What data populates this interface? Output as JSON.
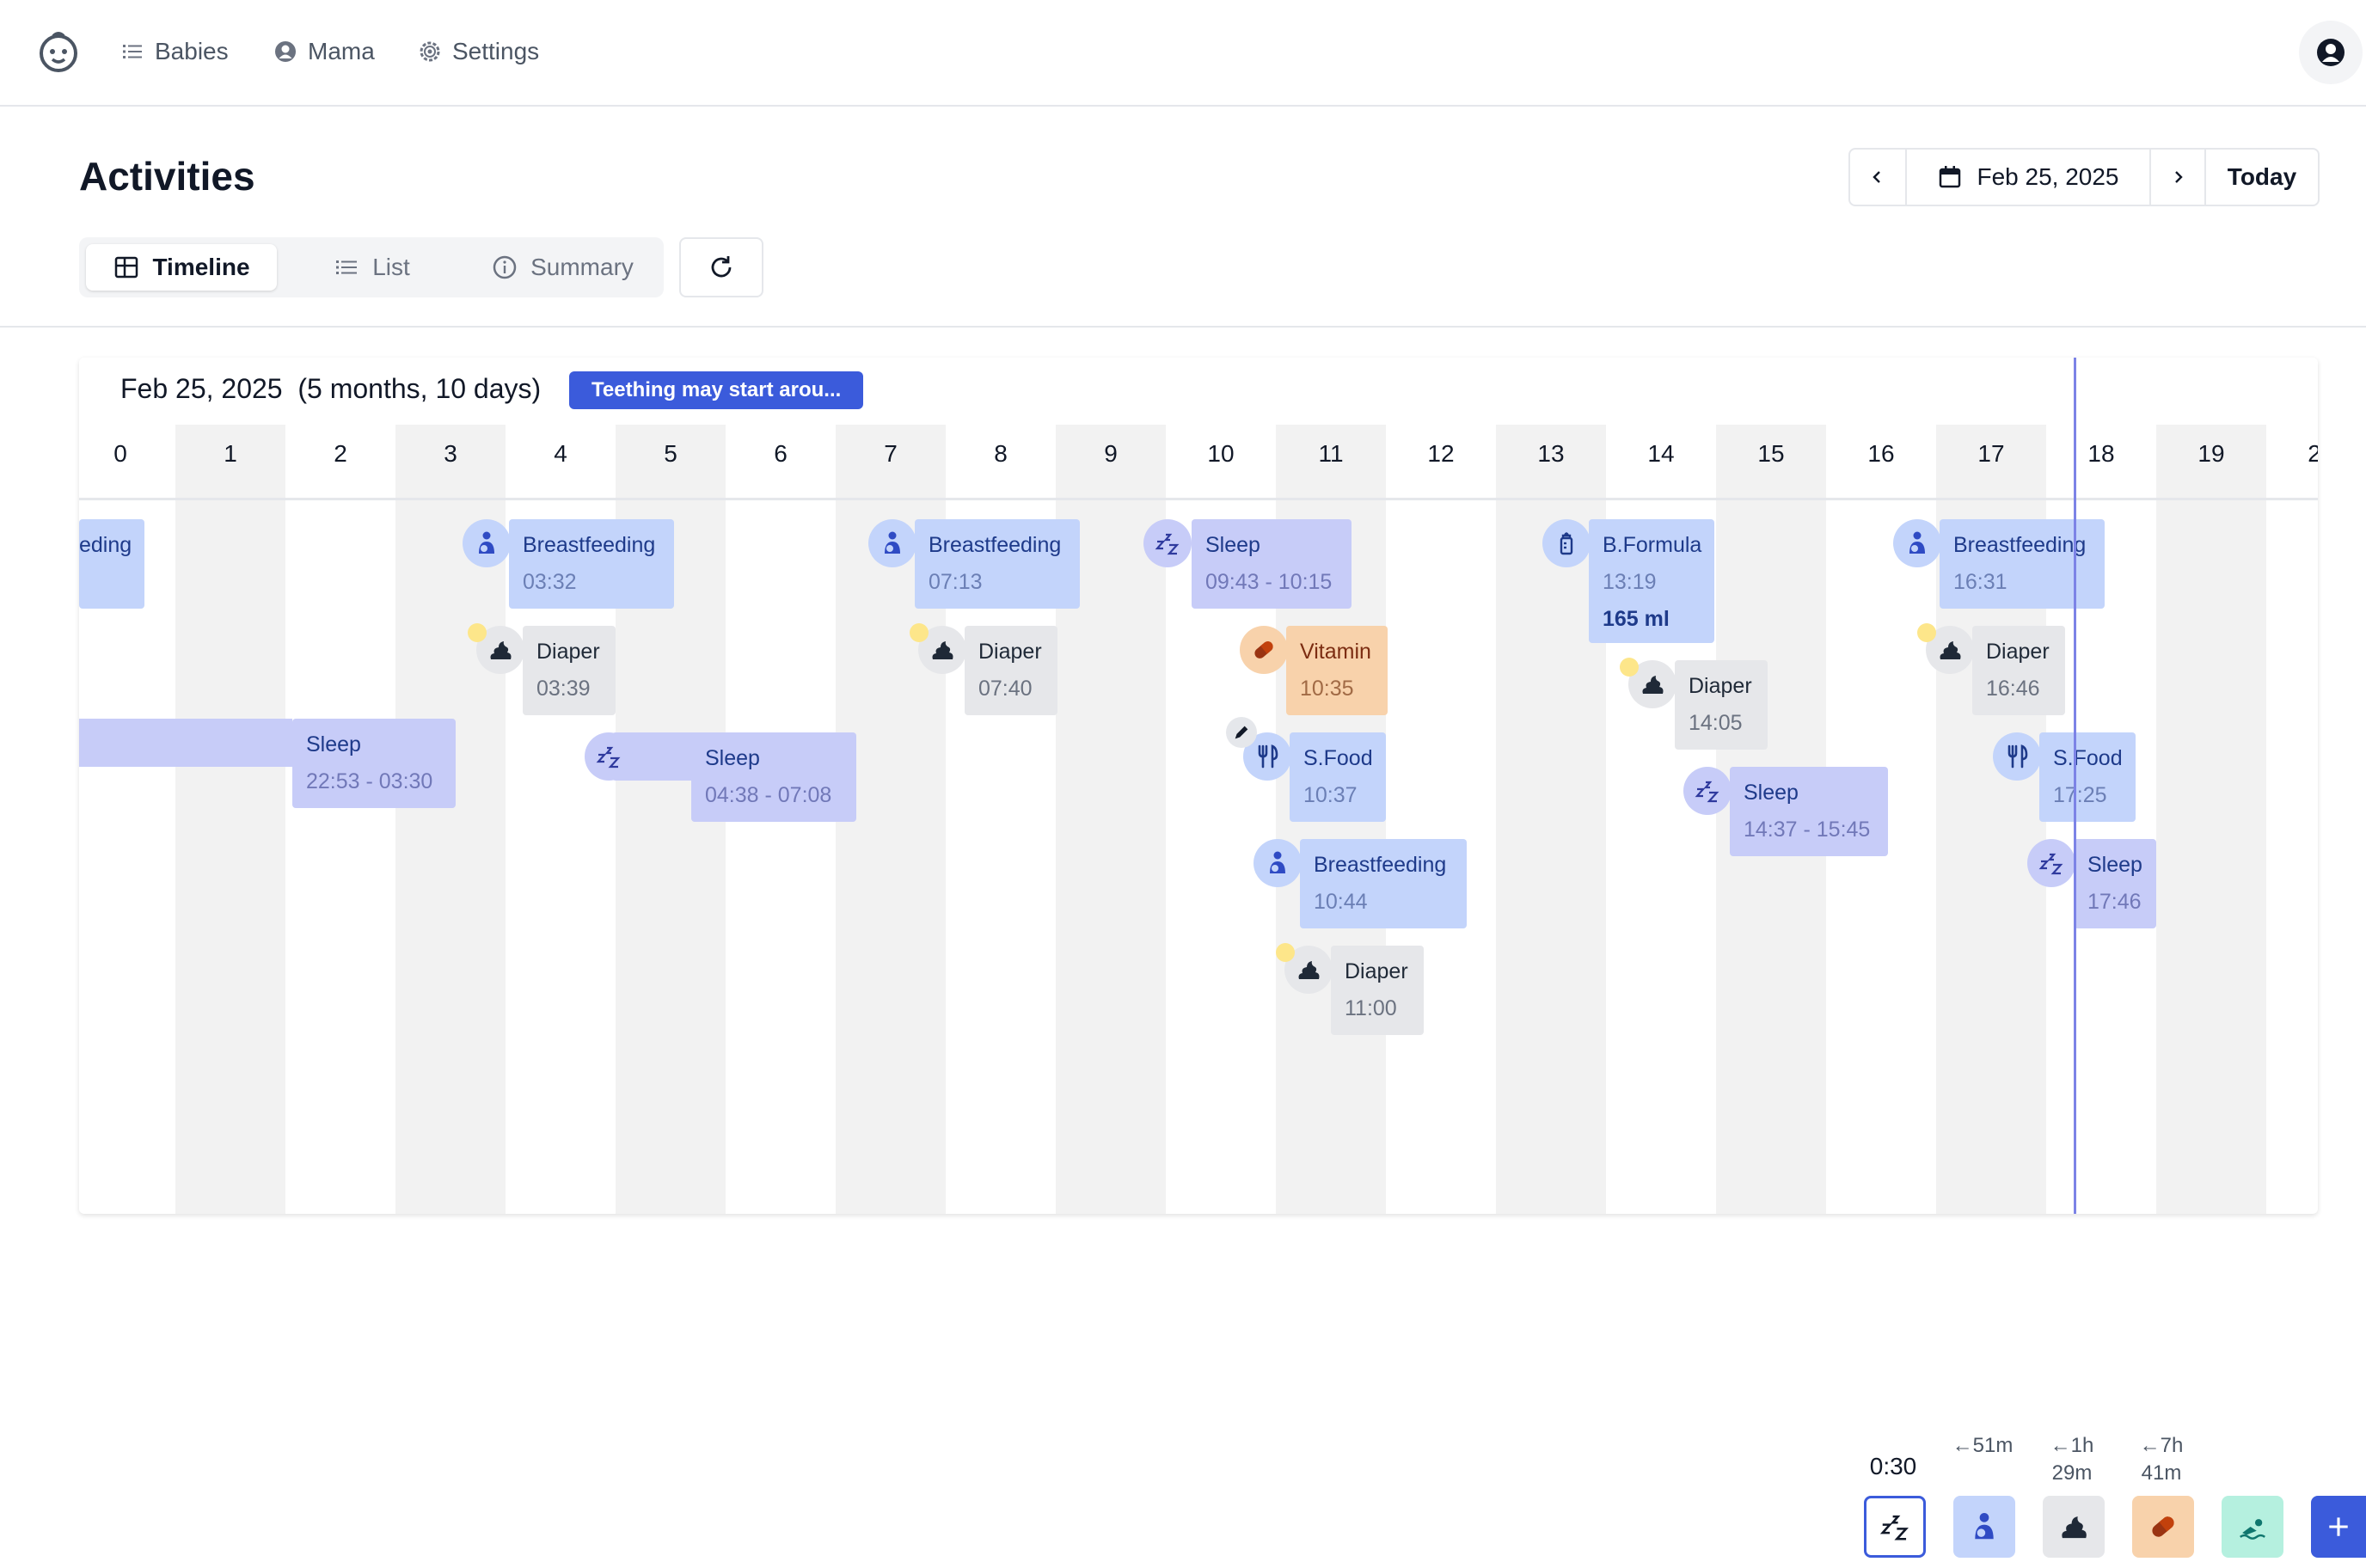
{
  "nav": {
    "items": [
      {
        "label": "Babies",
        "icon": "list-icon"
      },
      {
        "label": "Mama",
        "icon": "user-circle-icon"
      },
      {
        "label": "Settings",
        "icon": "gear-icon"
      }
    ],
    "logo_icon": "baby-face-icon",
    "avatar_icon": "user-avatar-icon"
  },
  "header": {
    "title": "Activities",
    "date": "Feb 25, 2025",
    "today_label": "Today"
  },
  "tabs": [
    {
      "label": "Timeline",
      "icon": "grid-icon",
      "active": true
    },
    {
      "label": "List",
      "icon": "list-icon",
      "active": false
    },
    {
      "label": "Summary",
      "icon": "info-icon",
      "active": false
    }
  ],
  "timeline": {
    "date": "Feb 25, 2025",
    "age": "(5 months, 10 days)",
    "tip": "Teething may start arou...",
    "hours": [
      "0",
      "1",
      "2",
      "3",
      "4",
      "5",
      "6",
      "7",
      "8",
      "9",
      "10",
      "11",
      "12",
      "13",
      "14",
      "15",
      "16",
      "17",
      "18",
      "19",
      "2"
    ],
    "events": [
      {
        "type": "feed",
        "name": "eding"
      },
      {
        "type": "feed",
        "name": "Breastfeeding",
        "time": "03:32"
      },
      {
        "type": "diaper",
        "name": "Diaper",
        "time": "03:39"
      },
      {
        "type": "sleep",
        "name": "Sleep",
        "time": "22:53 - 03:30"
      },
      {
        "type": "sleep",
        "name": "Sleep",
        "time": "04:38 - 07:08"
      },
      {
        "type": "feed",
        "name": "Breastfeeding",
        "time": "07:13"
      },
      {
        "type": "diaper",
        "name": "Diaper",
        "time": "07:40"
      },
      {
        "type": "sleep",
        "name": "Sleep",
        "time": "09:43 - 10:15"
      },
      {
        "type": "vitamin",
        "name": "Vitamin",
        "time": "10:35"
      },
      {
        "type": "food",
        "name": "S.Food",
        "time": "10:37"
      },
      {
        "type": "feed",
        "name": "Breastfeeding",
        "time": "10:44"
      },
      {
        "type": "diaper",
        "name": "Diaper",
        "time": "11:00"
      },
      {
        "type": "formula",
        "name": "B.Formula",
        "time": "13:19",
        "amount": "165 ml"
      },
      {
        "type": "diaper",
        "name": "Diaper",
        "time": "14:05"
      },
      {
        "type": "sleep",
        "name": "Sleep",
        "time": "14:37 - 15:45"
      },
      {
        "type": "feed",
        "name": "Breastfeeding",
        "time": "16:31"
      },
      {
        "type": "diaper",
        "name": "Diaper",
        "time": "16:46"
      },
      {
        "type": "food",
        "name": "S.Food",
        "time": "17:25"
      },
      {
        "type": "sleep",
        "name": "Sleep",
        "time": "17:46"
      }
    ]
  },
  "quick_add": {
    "sleep_timer": "0:30",
    "feed_since": "←51m",
    "diaper_since_1": "←1h",
    "diaper_since_2": "29m",
    "vitamin_since_1": "←7h",
    "vitamin_since_2": "41m",
    "colors": {
      "sleep": "#ffffff",
      "feed": "#c3d4fb",
      "diaper": "#e6e7ea",
      "vitamin": "#f8d2ab",
      "bath": "#b5f0df",
      "add": "#3b5bdb"
    }
  }
}
